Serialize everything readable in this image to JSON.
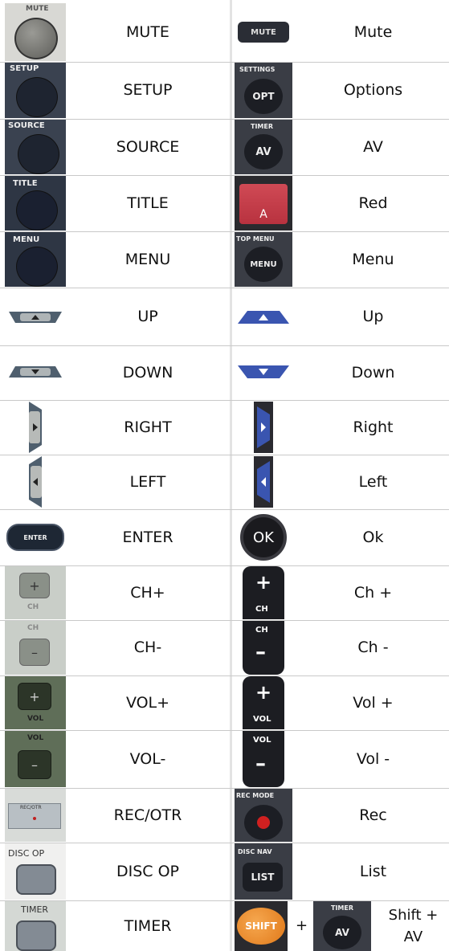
{
  "rows": [
    {
      "left": "MUTE",
      "right": "Mute",
      "left_icon": {
        "caption": "MUTE"
      },
      "right_icon": {
        "caption": "MUTE"
      }
    },
    {
      "left": "SETUP",
      "right": "Options",
      "left_icon": {
        "caption": "SETUP"
      },
      "right_icon": {
        "caption": "SETTINGS",
        "face": "OPT"
      }
    },
    {
      "left": "SOURCE",
      "right": "AV",
      "left_icon": {
        "caption": "SOURCE"
      },
      "right_icon": {
        "caption": "TIMER",
        "face": "AV"
      }
    },
    {
      "left": "TITLE",
      "right": "Red",
      "left_icon": {
        "caption": "TITLE"
      },
      "right_icon": {
        "face": "A"
      }
    },
    {
      "left": "MENU",
      "right": "Menu",
      "left_icon": {
        "caption": "MENU"
      },
      "right_icon": {
        "caption": "TOP MENU",
        "face": "MENU"
      }
    },
    {
      "left": "UP",
      "right": "Up"
    },
    {
      "left": "DOWN",
      "right": "Down"
    },
    {
      "left": "RIGHT",
      "right": "Right"
    },
    {
      "left": "LEFT",
      "right": "Left"
    },
    {
      "left": "ENTER",
      "right": "Ok",
      "left_icon": {
        "face": "ENTER"
      },
      "right_icon": {
        "face": "OK"
      }
    },
    {
      "left": "CH+",
      "right": "Ch +",
      "left_icon": {
        "face": "+",
        "caption": "CH"
      },
      "right_icon": {
        "face": "+",
        "caption": "CH"
      }
    },
    {
      "left": "CH-",
      "right": "Ch -",
      "left_icon": {
        "face": "–",
        "caption": "CH"
      },
      "right_icon": {
        "face": "–",
        "caption": "CH"
      }
    },
    {
      "left": "VOL+",
      "right": "Vol +",
      "left_icon": {
        "face": "+",
        "caption": "VOL"
      },
      "right_icon": {
        "face": "+",
        "caption": "VOL"
      }
    },
    {
      "left": "VOL-",
      "right": "Vol -",
      "left_icon": {
        "face": "–",
        "caption": "VOL"
      },
      "right_icon": {
        "face": "–",
        "caption": "VOL"
      }
    },
    {
      "left": "REC/OTR",
      "right": "Rec",
      "left_icon": {
        "caption": "REC/OTR"
      },
      "right_icon": {
        "caption": "REC MODE"
      }
    },
    {
      "left": "DISC OP",
      "right": "List",
      "left_icon": {
        "caption": "DISC OP"
      },
      "right_icon": {
        "caption": "DISC NAV",
        "face": "LIST"
      }
    },
    {
      "left": "TIMER",
      "right": "Shift + AV",
      "left_icon": {
        "caption": "TIMER"
      },
      "right_icon": {
        "face": "SHIFT",
        "plus": "+",
        "caption2": "TIMER",
        "face2": "AV"
      }
    }
  ]
}
